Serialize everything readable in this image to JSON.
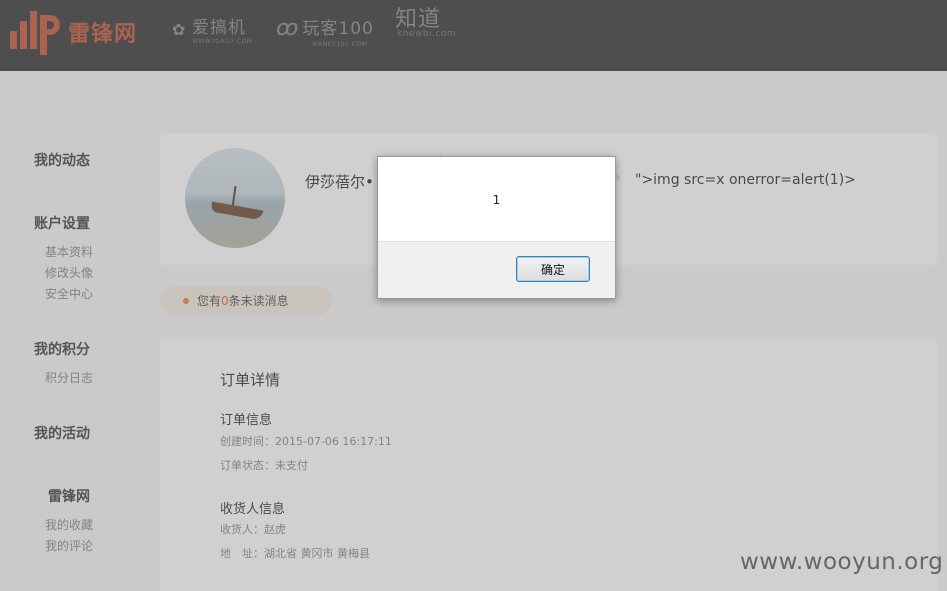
{
  "header": {
    "brand_name": "雷锋网",
    "partners": [
      {
        "name": "爱搞机",
        "sub": "WWW.IGAO7.COM"
      },
      {
        "name": "玩客100",
        "sub": "WANKE100.COM"
      },
      {
        "name": "知道",
        "sub": "knewbi.com"
      }
    ]
  },
  "sidebar": {
    "sections": [
      {
        "title": "我的动态",
        "links": []
      },
      {
        "title": "账户设置",
        "links": [
          "基本资料",
          "修改头像",
          "安全中心"
        ]
      },
      {
        "title": "我的积分",
        "links": [
          "积分日志"
        ]
      },
      {
        "title": "我的活动",
        "links": []
      },
      {
        "title": "雷锋网",
        "links": [
          "我的收藏",
          "我的评论"
        ]
      }
    ]
  },
  "profile": {
    "name": "伊莎蓓尔•",
    "injected_text": "\">img src=x onerror=alert(1)>"
  },
  "notice": {
    "prefix": "您有",
    "count": "0",
    "suffix": "条未读消息"
  },
  "order": {
    "title": "订单详情",
    "info_heading": "订单信息",
    "created": "创建时间：2015-07-06 16:17:11",
    "status": "订单状态：未支付",
    "receiver_heading": "收货人信息",
    "receiver": "收货人：赵虎",
    "address": "地　址：湖北省 黄冈市 黄梅县"
  },
  "dialog": {
    "message": "1",
    "ok_label": "确定"
  },
  "watermark": "www.wooyun.org"
}
